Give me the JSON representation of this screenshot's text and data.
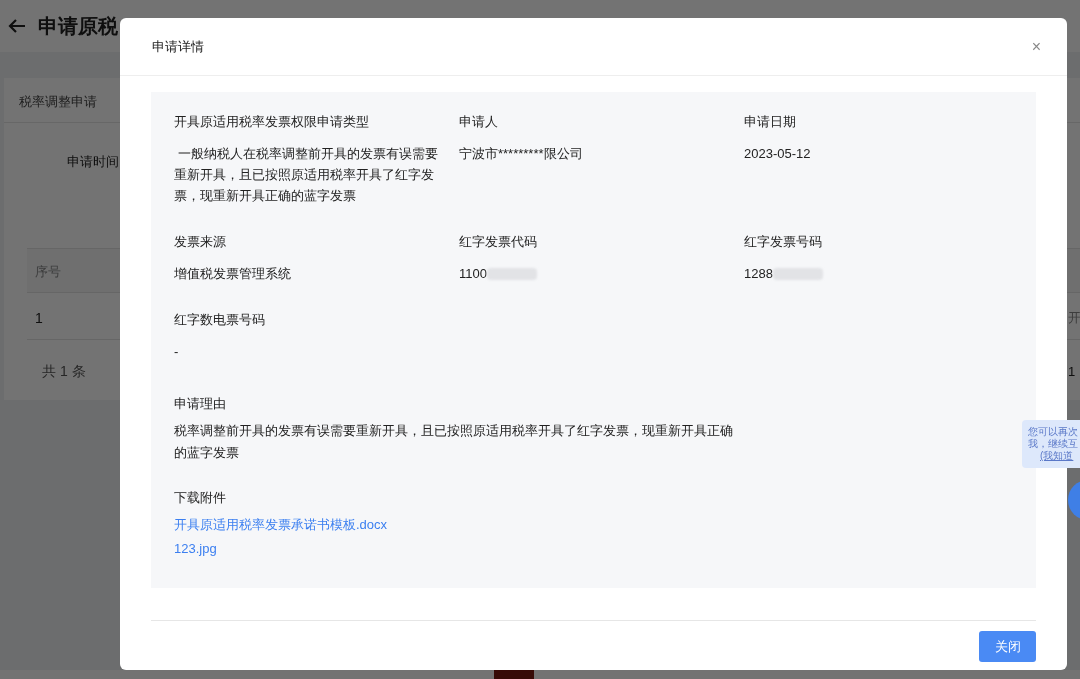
{
  "page": {
    "title": "申请原税",
    "tab": "税率调整申请",
    "filter_label": "申请时间",
    "table": {
      "columns": [
        "序号"
      ],
      "rows": [
        [
          "1"
        ]
      ]
    },
    "total": "共 1 条",
    "right_cell": "开",
    "right_cell_2": "1"
  },
  "modal": {
    "title": "申请详情",
    "close": "×",
    "fields": [
      {
        "label": "开具原适用税率发票权限申请类型",
        "value": " 一般纳税人在税率调整前开具的发票有误需要重新开具，且已按照原适用税率开具了红字发票，现重新开具正确的蓝字发票"
      },
      {
        "label": "申请人",
        "value": "宁波市*********限公司"
      },
      {
        "label": "申请日期",
        "value": "2023-05-12"
      },
      {
        "label": "发票来源",
        "value": "增值税发票管理系统"
      },
      {
        "label": "红字发票代码",
        "value": "1100",
        "redacted": true
      },
      {
        "label": "红字发票号码",
        "value": "1288",
        "redacted": true
      },
      {
        "label": "红字数电票号码",
        "value": "-"
      }
    ],
    "reason": {
      "label": "申请理由",
      "value": "税率调整前开具的发票有误需要重新开具，且已按照原适用税率开具了红字发票，现重新开具正确的蓝字发票"
    },
    "attachments": {
      "label": "下载附件",
      "files": [
        "开具原适用税率发票承诺书模板.docx",
        "123.jpg"
      ]
    },
    "button": "关闭"
  },
  "tooltip": {
    "lines": [
      "您可以再次",
      "我，继续互",
      "(我知道"
    ]
  }
}
